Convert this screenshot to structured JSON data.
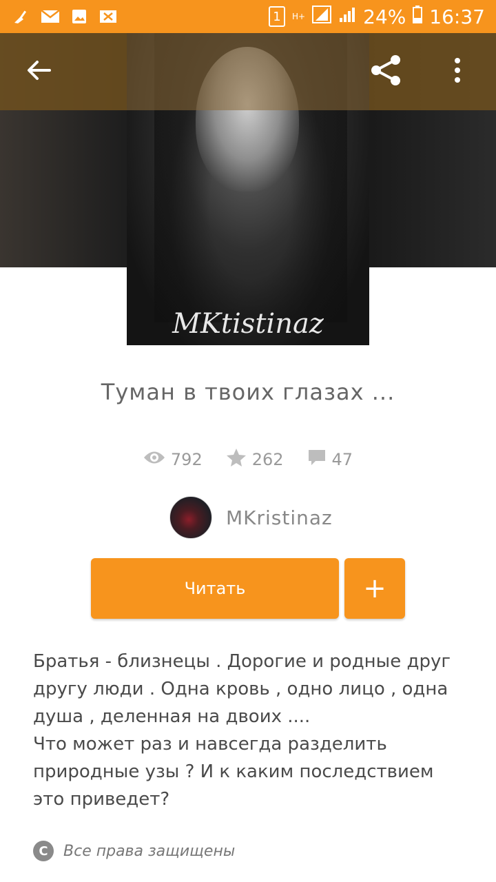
{
  "status_bar": {
    "left_icons": [
      "broom-icon",
      "mail-icon",
      "image-icon",
      "mail-x-icon"
    ],
    "sim": "1",
    "network": "H+",
    "battery": "24%",
    "time": "16:37"
  },
  "toolbar": {
    "back_icon": "arrow-left-icon",
    "share_icon": "share-icon",
    "more_icon": "more-vertical-icon"
  },
  "cover": {
    "signature": "MKtistinaz"
  },
  "story": {
    "title": "Туман в твоих глазах ...",
    "reads": "792",
    "votes": "262",
    "comments": "47",
    "author": "MKristinaz",
    "read_label": "Читать",
    "add_label": "+",
    "description_1": "Братья - близнецы . Дорогие и родные друг другу люди . Одна кровь , одно лицо , одна душа , деленная на двоих ....",
    "description_2": "Что может раз и навсегда разделить природные узы ?  И к каким последствием это приведет?",
    "copyright": "Все права защищены"
  },
  "colors": {
    "accent": "#f7941d",
    "text_gray": "#4a4a4a"
  }
}
